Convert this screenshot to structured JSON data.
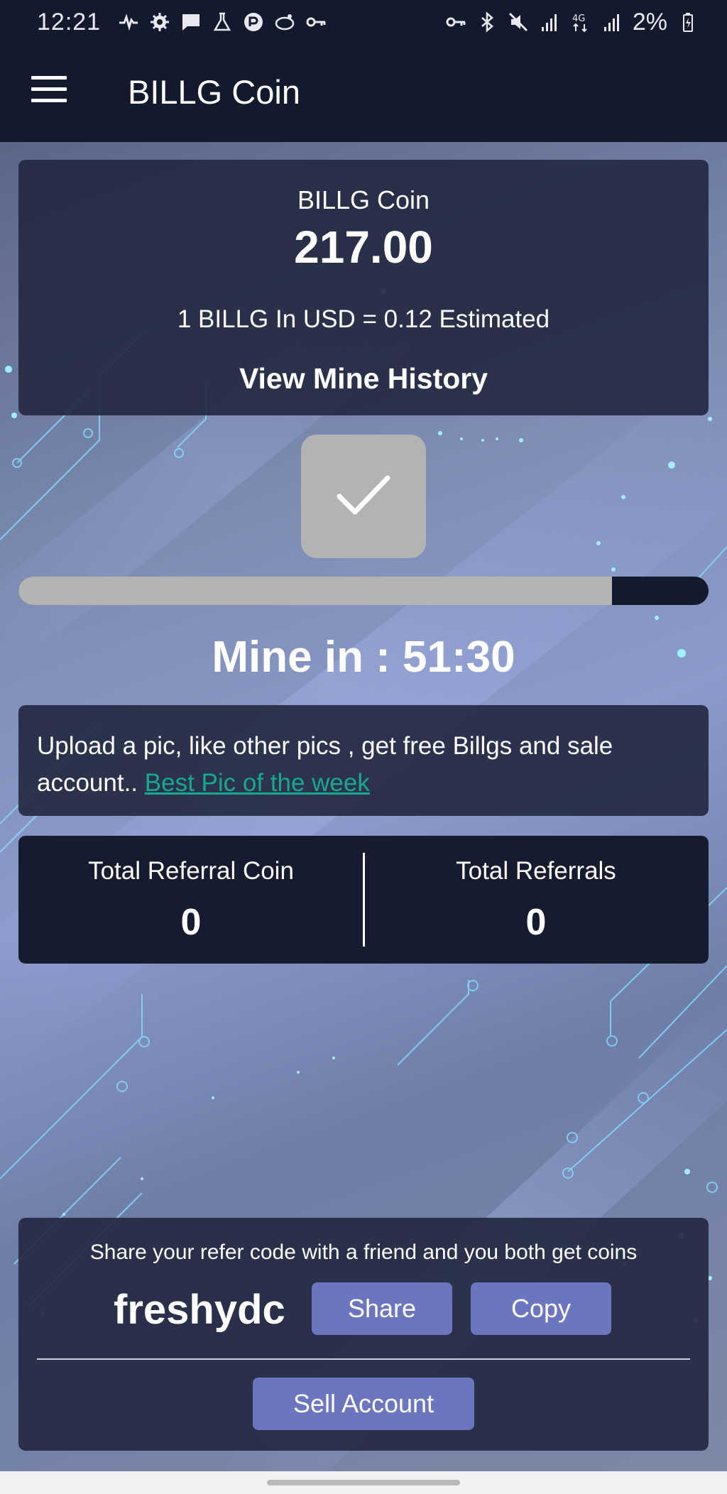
{
  "status_bar": {
    "time": "12:21",
    "battery": "2%",
    "icons": [
      "signal-wave-icon",
      "gear-icon",
      "chat-icon",
      "flask-icon",
      "app-circle-icon",
      "link-icon",
      "key-icon"
    ],
    "right_icons": [
      "vpn-key-icon",
      "bluetooth-icon",
      "mute-icon",
      "signal-icon",
      "4g-icon",
      "signal-icon",
      "battery-charging-icon"
    ]
  },
  "app_bar": {
    "title": "BILLG Coin"
  },
  "balance": {
    "coin_name": "BILLG Coin",
    "amount": "217.00",
    "rate": "1 BILLG In USD = 0.12 Estimated",
    "history_link": "View Mine History"
  },
  "mining": {
    "progress_percent": 86,
    "timer_text": "Mine in : 51:30"
  },
  "promo": {
    "text": "Upload a pic, like other pics , get free Billgs and sale account.. ",
    "link": "Best Pic of the week "
  },
  "referrals": {
    "coin_label": "Total Referral Coin",
    "coin_value": "0",
    "count_label": "Total Referrals",
    "count_value": "0"
  },
  "share": {
    "message": "Share your refer code with a friend and you both get coins",
    "code": "freshydc",
    "share_label": "Share",
    "copy_label": "Copy",
    "sell_label": "Sell Account"
  },
  "colors": {
    "bar": "#141a2e",
    "card": "#242942",
    "button": "#6c76c0",
    "link": "#17a98e"
  }
}
